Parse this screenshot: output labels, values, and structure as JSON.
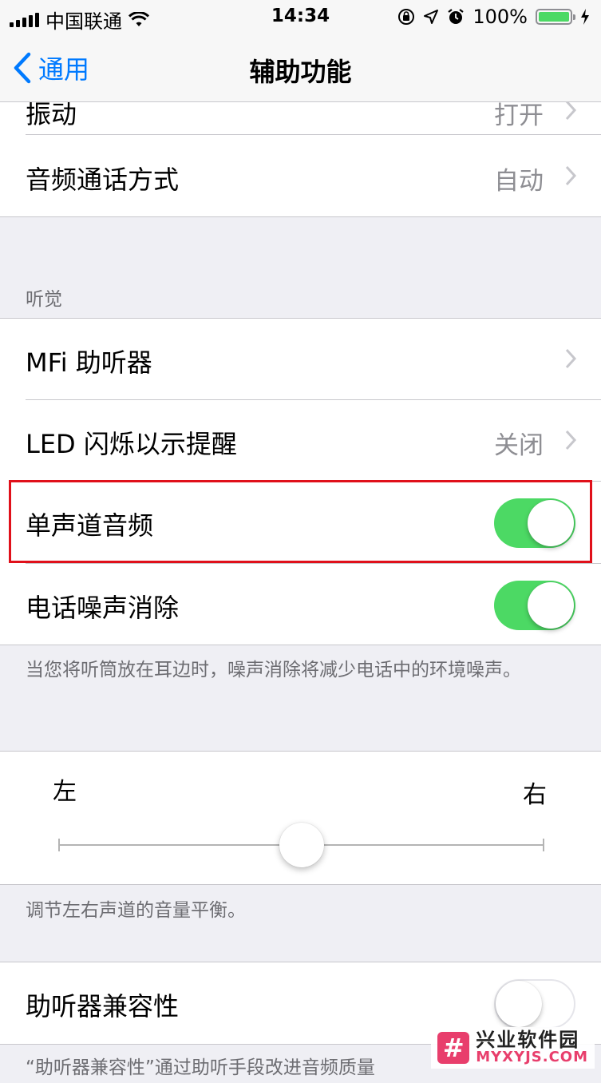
{
  "status_bar": {
    "carrier": "中国联通",
    "time": "14:34",
    "battery": "100%"
  },
  "nav": {
    "back_label": "通用",
    "title": "辅助功能"
  },
  "top_group": {
    "partial_label": "振动",
    "partial_value": "打开",
    "audio_routing_label": "音频通话方式",
    "audio_routing_value": "自动"
  },
  "hearing": {
    "header": "听觉",
    "mfi_label": "MFi 助听器",
    "led_label": "LED 闪烁以示提醒",
    "led_value": "关闭",
    "mono_label": "单声道音频",
    "mono_on": true,
    "noise_label": "电话噪声消除",
    "noise_on": true,
    "noise_footer": "当您将听筒放在耳边时，噪声消除将减少电话中的环境噪声。"
  },
  "balance": {
    "left_label": "左",
    "right_label": "右",
    "value": 0.5,
    "footer": "调节左右声道的音量平衡。"
  },
  "hac": {
    "label": "助听器兼容性",
    "on": false,
    "footer": "“助听器兼容性”通过助听手段改进音频质量"
  },
  "watermark": {
    "logo_glyph": "#",
    "text_cn": "兴业软件园",
    "text_en": "MYXYJS.COM"
  },
  "colors": {
    "accent": "#007aff",
    "toggle_on": "#4cd964",
    "highlight_box": "#e0101a"
  }
}
